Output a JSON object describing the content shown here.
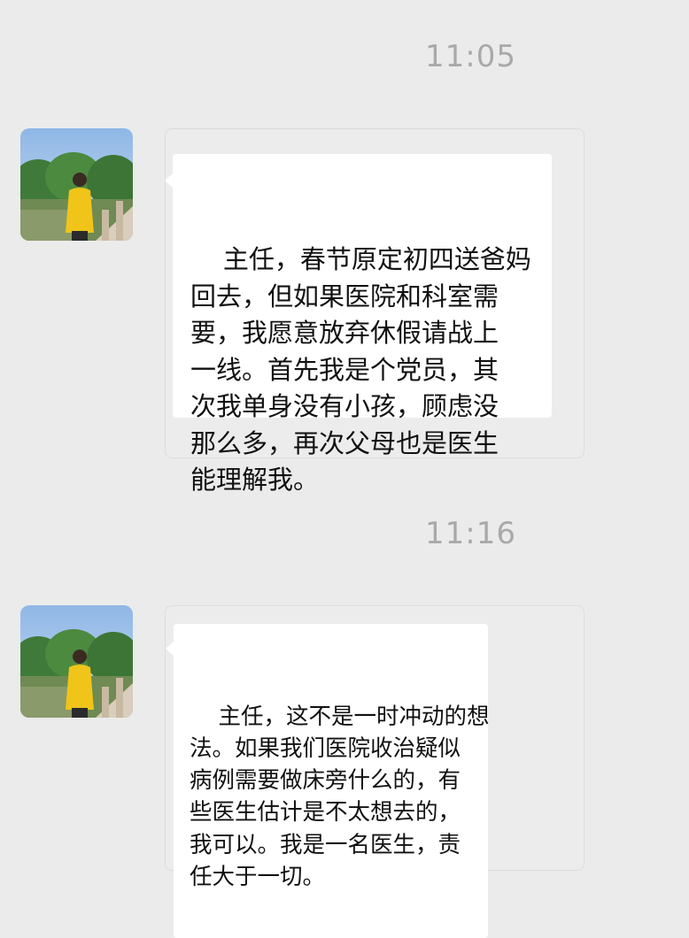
{
  "chat": {
    "messages": [
      {
        "time": "11:05",
        "text": "主任，春节原定初四送爸妈\n回去，但如果医院和科室需\n要，我愿意放弃休假请战上\n一线。首先我是个党员，其\n次我单身没有小孩，顾虑没\n那么多，再次父母也是医生\n能理解我。",
        "avatar": "avatar-photo-icon"
      },
      {
        "time": "11:16",
        "text": "主任，这不是一时冲动的想\n法。如果我们医院收治疑似\n病例需要做床旁什么的，有\n些医生估计是不太想去的，\n我可以。我是一名医生，责\n任大于一切。",
        "avatar": "avatar-photo-icon"
      }
    ]
  },
  "colors": {
    "background": "#ebebeb",
    "bubble": "#ffffff",
    "timestamp": "#a9a9a9",
    "text": "#111111"
  }
}
